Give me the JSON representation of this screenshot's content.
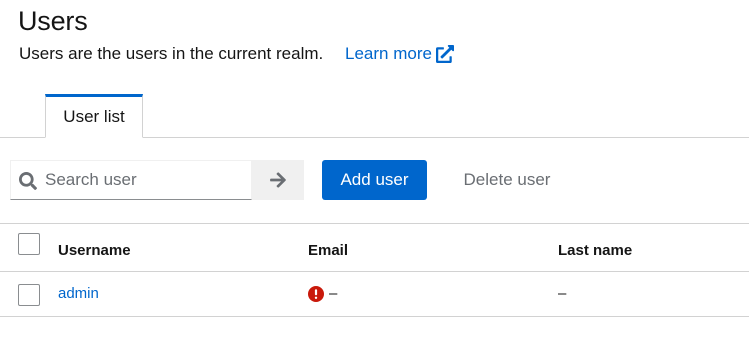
{
  "header": {
    "title": "Users",
    "subtitle": "Users are the users in the current realm.",
    "learn_more": "Learn more"
  },
  "tabs": [
    {
      "label": "User list",
      "active": true
    }
  ],
  "toolbar": {
    "search_placeholder": "Search user",
    "add_label": "Add user",
    "delete_label": "Delete user"
  },
  "table": {
    "columns": [
      "Username",
      "Email",
      "Last name"
    ],
    "rows": [
      {
        "username": "admin",
        "email": "–",
        "email_status": "error",
        "last_name": "–"
      }
    ]
  },
  "icons": {
    "search": "search-icon",
    "submit": "arrow-right-icon",
    "external": "external-link-icon",
    "email_error": "exclamation-circle-icon"
  },
  "colors": {
    "primary": "#0066cc",
    "danger": "#c9190b",
    "disabled_text": "#6a6e73",
    "border": "#d2d2d2"
  }
}
